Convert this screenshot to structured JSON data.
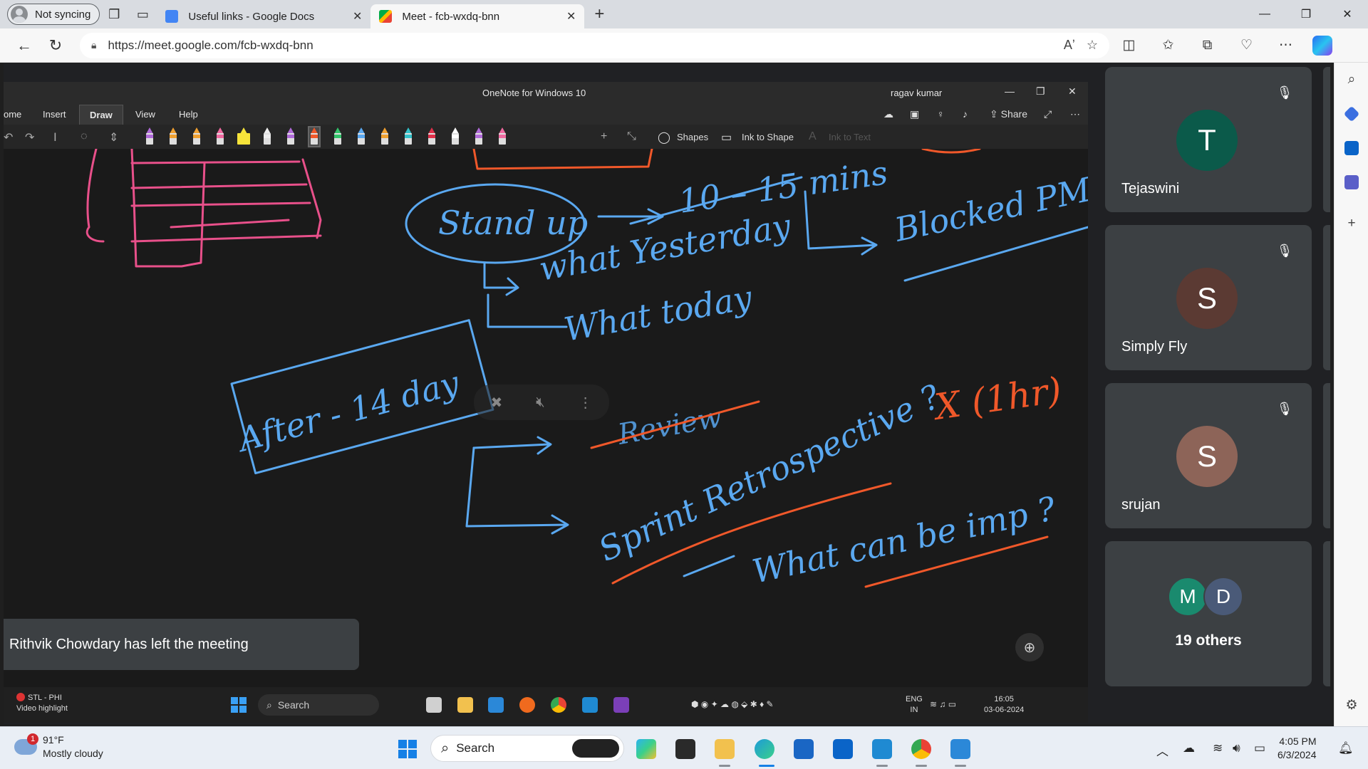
{
  "browser": {
    "profile_label": "Not syncing",
    "tabs": [
      {
        "title": "Useful links - Google Docs",
        "active": false
      },
      {
        "title": "Meet - fcb-wxdq-bnn",
        "active": true
      }
    ],
    "url": "https://meet.google.com/fcb-wxdq-bnn"
  },
  "onenote": {
    "app_title": "OneNote for Windows 10",
    "user": "ragav kumar",
    "menu": [
      "ome",
      "Insert",
      "Draw",
      "View",
      "Help"
    ],
    "share_label": "Share",
    "shapes_label": "Shapes",
    "ink_to_shape_label": "Ink to Shape",
    "ink_to_text_label": "Ink to Text",
    "pen_colors": [
      "#b06bd8",
      "#f0a030",
      "#f0a030",
      "#f06aa0",
      "#f7e43a",
      "#eeeeee",
      "#b06bd8",
      "#f0582a",
      "#33c36a",
      "#5aa8f0",
      "#f0a030",
      "#33c0c8",
      "#e0304a",
      "#ffffff",
      "#b06bd8",
      "#f06aa0"
    ]
  },
  "meet": {
    "toast": "Rithvik Chowdary has left the meeting",
    "participants": [
      {
        "initial": "T",
        "name": "Tejaswini",
        "color": "#0b5a4a"
      },
      {
        "initial": "S",
        "name": "Simply Fly",
        "color": "#5b3a33"
      },
      {
        "initial": "S",
        "name": "srujan",
        "color": "#8d6458"
      }
    ],
    "others": {
      "initials": [
        "M",
        "D"
      ],
      "colors": [
        "#1a8a6e",
        "#4a5a78"
      ],
      "label": "19 others"
    }
  },
  "remote_taskbar": {
    "weather_title": "STL - PHI",
    "weather_sub": "Video highlight",
    "search": "Search",
    "lang_top": "ENG",
    "lang_bottom": "IN",
    "time": "16:05",
    "date": "03-06-2024"
  },
  "host_taskbar": {
    "badge": "1",
    "temp": "91°F",
    "weather": "Mostly cloudy",
    "search": "Search",
    "time": "4:05 PM",
    "date": "6/3/2024"
  },
  "whiteboard_text": [
    "Stand up",
    "10 - 15 mins",
    "Blocked PM",
    "what Yesterday",
    "What today",
    "After - 14 day",
    "Review",
    "Sprint Retrospective ?",
    "X (1hr)",
    "What can be imp ?"
  ]
}
